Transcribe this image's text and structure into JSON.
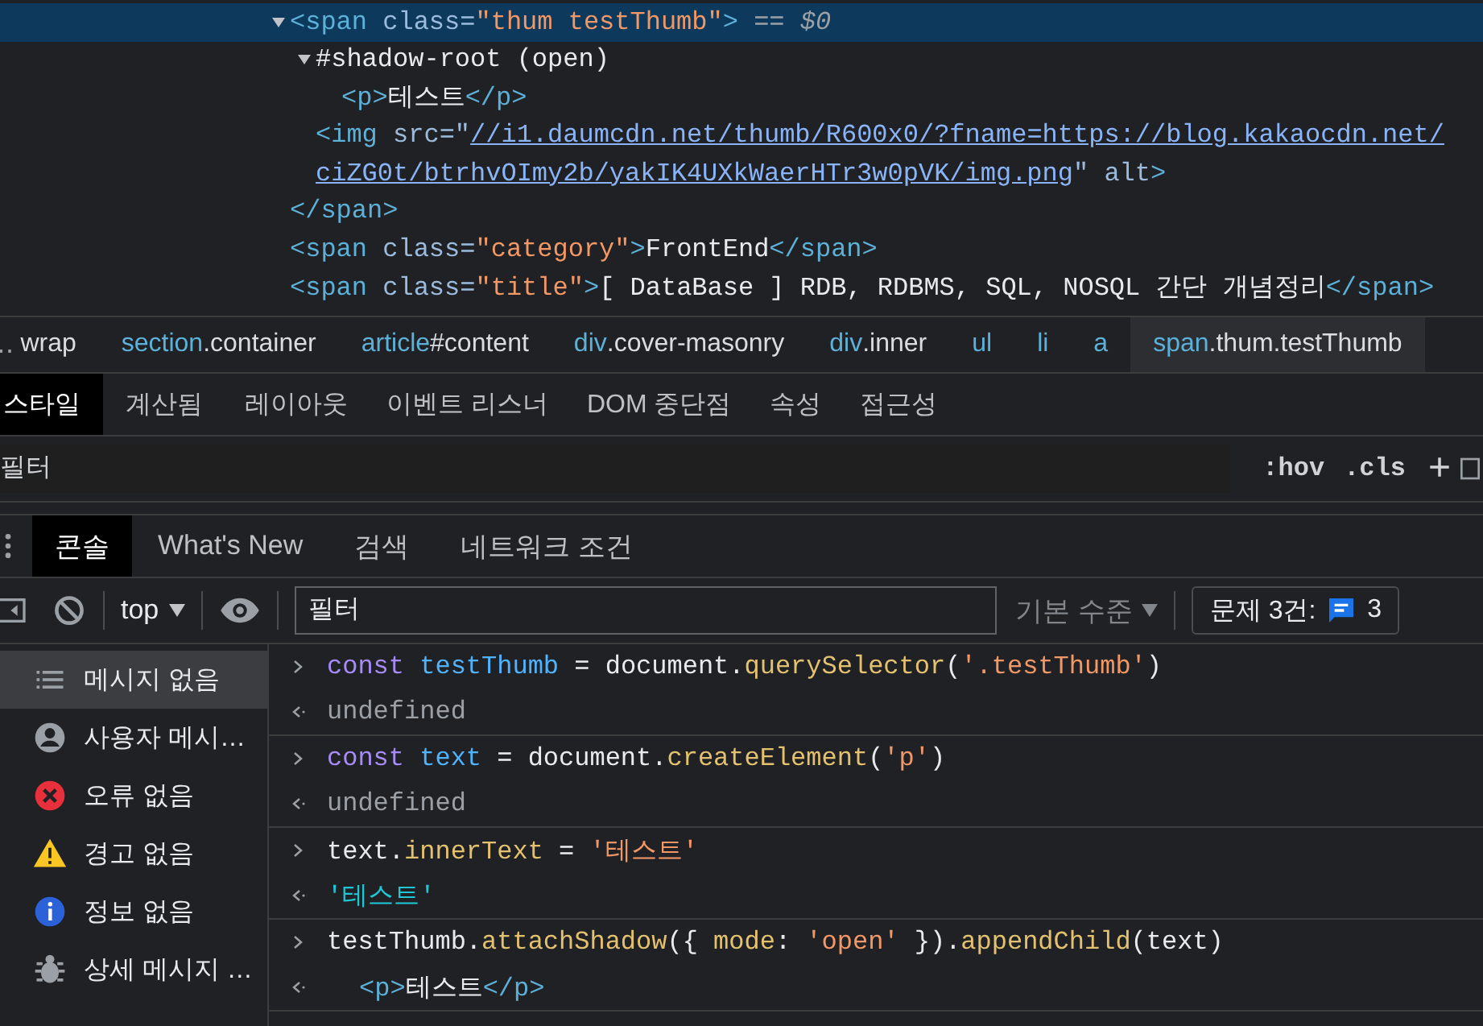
{
  "elements": {
    "nodes": [
      {
        "selected": true,
        "expanded": true,
        "lines": [
          [
            {
              "kind": "tag",
              "text": "<span"
            },
            {
              "kind": "attr",
              "text": " class="
            },
            {
              "kind": "value",
              "text": "\"thum testThumb\""
            },
            {
              "kind": "tag",
              "text": ">"
            },
            {
              "kind": "muted",
              "text": " == $0"
            }
          ]
        ],
        "children": [
          {
            "selected": false,
            "expanded": true,
            "lines": [
              [
                {
                  "kind": "text",
                  "text": "#shadow-root (open)"
                }
              ]
            ],
            "children": [
              {
                "selected": false,
                "lines": [
                  [
                    {
                      "kind": "tag",
                      "text": "<p>"
                    },
                    {
                      "kind": "text",
                      "text": "테스트"
                    },
                    {
                      "kind": "tag",
                      "text": "</p>"
                    }
                  ]
                ]
              }
            ]
          },
          {
            "selected": false,
            "lines": [
              [
                {
                  "kind": "tag",
                  "text": "<img"
                },
                {
                  "kind": "attr",
                  "text": " src="
                },
                {
                  "kind": "attr",
                  "text": "\""
                },
                {
                  "kind": "link",
                  "text": "//i1.daumcdn.net/thumb/R600x0/?fname=https://blog.kakaocdn.net/"
                }
              ],
              [
                {
                  "kind": "link",
                  "text": "ciZG0t/btrhvOImy2b/yakIK4UXkWaerHTr3w0pVK/img.png"
                },
                {
                  "kind": "attr",
                  "text": "\" alt"
                },
                {
                  "kind": "tag",
                  "text": ">"
                }
              ]
            ]
          }
        ],
        "closing": [
          {
            "kind": "tag",
            "text": "</span>"
          }
        ]
      },
      {
        "selected": false,
        "lines": [
          [
            {
              "kind": "tag",
              "text": "<span"
            },
            {
              "kind": "attr",
              "text": " class="
            },
            {
              "kind": "value",
              "text": "\"category\""
            },
            {
              "kind": "tag",
              "text": ">"
            },
            {
              "kind": "text",
              "text": "FrontEnd"
            },
            {
              "kind": "tag",
              "text": "</span>"
            }
          ]
        ]
      },
      {
        "selected": false,
        "lines": [
          [
            {
              "kind": "tag",
              "text": "<span"
            },
            {
              "kind": "attr",
              "text": " class="
            },
            {
              "kind": "value",
              "text": "\"title\""
            },
            {
              "kind": "tag",
              "text": ">"
            },
            {
              "kind": "text",
              "text": "[ DataBase ] RDB, RDBMS, SQL, NOSQL 간단 개념정리"
            },
            {
              "kind": "tag",
              "text": "</span>"
            }
          ]
        ]
      }
    ]
  },
  "breadcrumbs": {
    "overflow": "‥",
    "items": [
      {
        "rest": "wrap",
        "selected": false
      },
      {
        "tag": "section",
        "rest": ".container",
        "selected": false
      },
      {
        "tag": "article",
        "rest": "#content",
        "selected": false
      },
      {
        "tag": "div",
        "rest": ".cover-masonry",
        "selected": false
      },
      {
        "tag": "div",
        "rest": ".inner",
        "selected": false
      },
      {
        "tag": "ul",
        "selected": false
      },
      {
        "tag": "li",
        "selected": false
      },
      {
        "tag": "a",
        "selected": false
      },
      {
        "tag": "span",
        "rest": ".thum.testThumb",
        "selected": true
      }
    ]
  },
  "style_tabs": [
    {
      "label": "스타일",
      "selected": true
    },
    {
      "label": "계산됨",
      "selected": false
    },
    {
      "label": "레이아웃",
      "selected": false
    },
    {
      "label": "이벤트 리스너",
      "selected": false
    },
    {
      "label": "DOM 중단점",
      "selected": false
    },
    {
      "label": "속성",
      "selected": false
    },
    {
      "label": "접근성",
      "selected": false
    }
  ],
  "style_filter": {
    "placeholder": "필터",
    "hov": ":hov",
    "cls": ".cls",
    "add": "+"
  },
  "drawer_tabs": [
    {
      "label": "콘솔",
      "selected": true
    },
    {
      "label": "What's New",
      "selected": false
    },
    {
      "label": "검색",
      "selected": false
    },
    {
      "label": "네트워크 조건",
      "selected": false
    }
  ],
  "console_toolbar": {
    "context": "top",
    "filter_placeholder": "필터",
    "level": "기본 수준",
    "issues_label": "문제 3건:",
    "issues_count": "3"
  },
  "sidebar": [
    {
      "kind": "list",
      "label": "메시지 없음",
      "selected": true
    },
    {
      "kind": "user",
      "label": "사용자 메시…",
      "selected": false
    },
    {
      "kind": "error",
      "label": "오류 없음",
      "selected": false
    },
    {
      "kind": "warning",
      "label": "경고 없음",
      "selected": false
    },
    {
      "kind": "info",
      "label": "정보 없음",
      "selected": false
    },
    {
      "kind": "verbose",
      "label": "상세 메시지 …",
      "selected": false
    }
  ],
  "console": [
    {
      "kind": "input",
      "tokens": [
        {
          "kind": "keyword",
          "text": "const "
        },
        {
          "kind": "var",
          "text": "testThumb"
        },
        {
          "kind": "text",
          "text": " = document."
        },
        {
          "kind": "method",
          "text": "querySelector"
        },
        {
          "kind": "text",
          "text": "("
        },
        {
          "kind": "value",
          "text": "'.testThumb'"
        },
        {
          "kind": "text",
          "text": ")"
        }
      ]
    },
    {
      "kind": "output",
      "tokens": [
        {
          "kind": "muted",
          "text": "undefined"
        }
      ]
    },
    {
      "kind": "input",
      "tokens": [
        {
          "kind": "keyword",
          "text": "const "
        },
        {
          "kind": "var",
          "text": "text"
        },
        {
          "kind": "text",
          "text": " = document."
        },
        {
          "kind": "method",
          "text": "createElement"
        },
        {
          "kind": "text",
          "text": "("
        },
        {
          "kind": "value",
          "text": "'p'"
        },
        {
          "kind": "text",
          "text": ")"
        }
      ]
    },
    {
      "kind": "output",
      "tokens": [
        {
          "kind": "muted",
          "text": "undefined"
        }
      ]
    },
    {
      "kind": "input",
      "tokens": [
        {
          "kind": "text",
          "text": "text."
        },
        {
          "kind": "method",
          "text": "innerText"
        },
        {
          "kind": "text",
          "text": " = "
        },
        {
          "kind": "value",
          "text": "'테스트'"
        }
      ]
    },
    {
      "kind": "output",
      "tokens": [
        {
          "kind": "result",
          "text": "'테스트'"
        }
      ]
    },
    {
      "kind": "input",
      "tokens": [
        {
          "kind": "text",
          "text": "testThumb."
        },
        {
          "kind": "method",
          "text": "attachShadow"
        },
        {
          "kind": "text",
          "text": "({ "
        },
        {
          "kind": "method",
          "text": "mode"
        },
        {
          "kind": "text",
          "text": ": "
        },
        {
          "kind": "value",
          "text": "'open'"
        },
        {
          "kind": "text",
          "text": " })."
        },
        {
          "kind": "method",
          "text": "appendChild"
        },
        {
          "kind": "text",
          "text": "(text)"
        }
      ]
    },
    {
      "kind": "output",
      "tokens": [
        {
          "kind": "tag",
          "text": "<p>"
        },
        {
          "kind": "text",
          "text": "테스트"
        },
        {
          "kind": "tag",
          "text": "</p>"
        }
      ]
    }
  ]
}
